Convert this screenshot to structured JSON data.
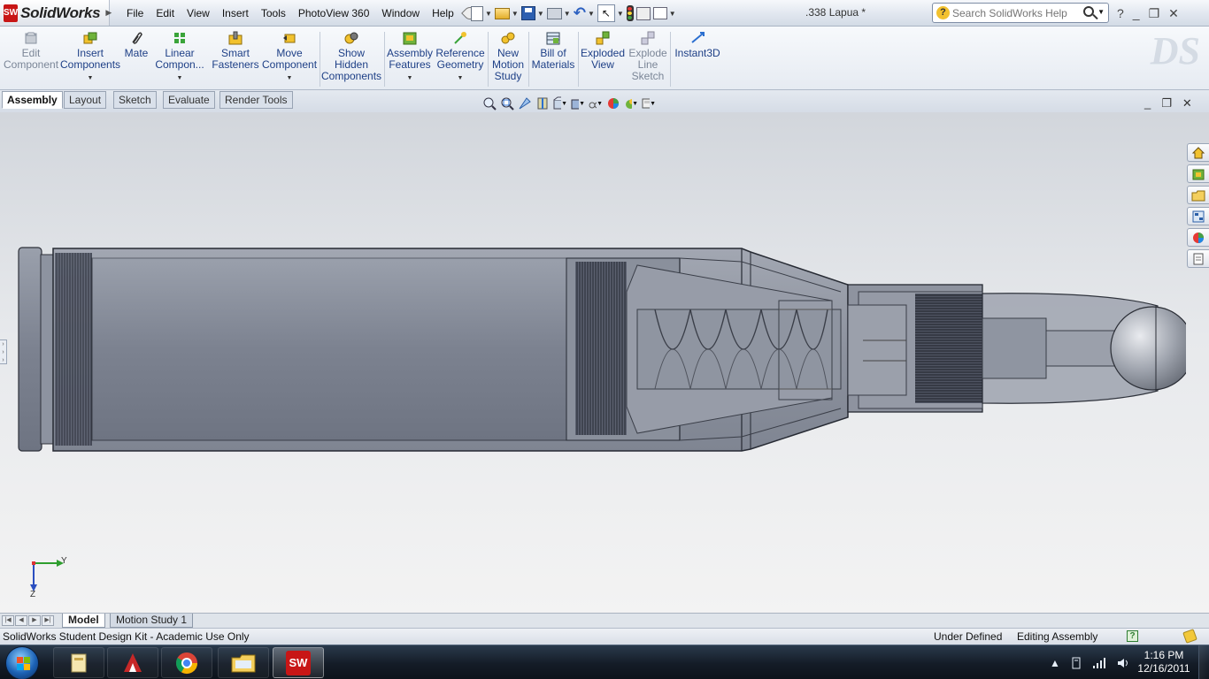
{
  "app": {
    "logo_badge": "SW",
    "logo_text": "SolidWorks",
    "document_title": ".338 Lapua *",
    "brand_color": "#c81616"
  },
  "menu": [
    "File",
    "Edit",
    "View",
    "Insert",
    "Tools",
    "PhotoView 360",
    "Window",
    "Help"
  ],
  "quick_access_icons": [
    "new-document-icon",
    "open-folder-icon",
    "save-icon",
    "print-icon",
    "undo-icon",
    "select-arrow-icon",
    "rebuild-traffic-light-icon",
    "file-properties-icon",
    "options-icon"
  ],
  "help_search": {
    "placeholder": "Search SolidWorks Help",
    "help_glyph": "?"
  },
  "window_controls": {
    "help": "?",
    "minimize": "_",
    "restore": "❐",
    "close": "✕"
  },
  "command_manager": [
    {
      "label": "Edit Component",
      "lines": [
        "Edit",
        "Component"
      ],
      "enabled": false,
      "icon": "edit-component-icon"
    },
    {
      "label": "Insert Components",
      "lines": [
        "Insert",
        "Components"
      ],
      "enabled": true,
      "icon": "insert-components-icon",
      "dropdown": true
    },
    {
      "label": "Mate",
      "lines": [
        "Mate"
      ],
      "enabled": true,
      "icon": "mate-paperclip-icon"
    },
    {
      "label": "Linear Component Pattern",
      "lines": [
        "Linear",
        "Compon..."
      ],
      "enabled": true,
      "icon": "linear-pattern-icon",
      "dropdown": true
    },
    {
      "label": "Smart Fasteners",
      "lines": [
        "Smart",
        "Fasteners"
      ],
      "enabled": true,
      "icon": "smart-fasteners-icon"
    },
    {
      "label": "Move Component",
      "lines": [
        "Move",
        "Component"
      ],
      "enabled": true,
      "icon": "move-component-icon",
      "dropdown": true
    },
    {
      "label": "Show Hidden Components",
      "lines": [
        "Show",
        "Hidden",
        "Components"
      ],
      "enabled": true,
      "icon": "show-hidden-icon"
    },
    {
      "label": "Assembly Features",
      "lines": [
        "Assembly",
        "Features"
      ],
      "enabled": true,
      "icon": "assembly-features-icon",
      "dropdown": true
    },
    {
      "label": "Reference Geometry",
      "lines": [
        "Reference",
        "Geometry"
      ],
      "enabled": true,
      "icon": "reference-geometry-icon",
      "dropdown": true
    },
    {
      "label": "New Motion Study",
      "lines": [
        "New",
        "Motion",
        "Study"
      ],
      "enabled": true,
      "icon": "motion-study-icon"
    },
    {
      "label": "Bill of Materials",
      "lines": [
        "Bill of",
        "Materials"
      ],
      "enabled": true,
      "icon": "bill-of-materials-icon"
    },
    {
      "label": "Exploded View",
      "lines": [
        "Exploded",
        "View"
      ],
      "enabled": true,
      "icon": "exploded-view-icon"
    },
    {
      "label": "Explode Line Sketch",
      "lines": [
        "Explode",
        "Line",
        "Sketch"
      ],
      "enabled": false,
      "icon": "explode-line-sketch-icon"
    },
    {
      "label": "Instant3D",
      "lines": [
        "Instant3D"
      ],
      "enabled": true,
      "icon": "instant3d-icon"
    }
  ],
  "tabs": [
    "Assembly",
    "Layout",
    "Sketch",
    "Evaluate",
    "Render Tools"
  ],
  "active_tab": "Assembly",
  "heads_up_view_toolbar": [
    "zoom-to-fit-icon",
    "zoom-to-area-icon",
    "previous-view-icon",
    "section-view-icon",
    "view-orientation-icon",
    "display-style-icon",
    "hide-show-items-icon",
    "edit-appearance-icon",
    "apply-scene-icon",
    "view-settings-icon"
  ],
  "task_pane": [
    "solidworks-resources-home-icon",
    "design-library-icon",
    "file-explorer-icon",
    "view-palette-icon",
    "appearances-scenes-icon",
    "custom-properties-icon"
  ],
  "triad": {
    "y_label": "Y",
    "z_label": "Z"
  },
  "bottom_tabs": [
    "Model",
    "Motion Study 1"
  ],
  "active_bottom_tab": "Model",
  "status": {
    "left": "SolidWorks Student Design Kit - Academic Use Only",
    "definition": "Under Defined",
    "mode": "Editing Assembly"
  },
  "taskbar": {
    "apps": [
      "windows-explorer-icon",
      "autocad-icon",
      "chrome-icon",
      "folder-icon",
      "solidworks-icon"
    ],
    "active_app": "solidworks-icon",
    "sw_label": "SW",
    "time": "1:16 PM",
    "date": "12/16/2011"
  }
}
